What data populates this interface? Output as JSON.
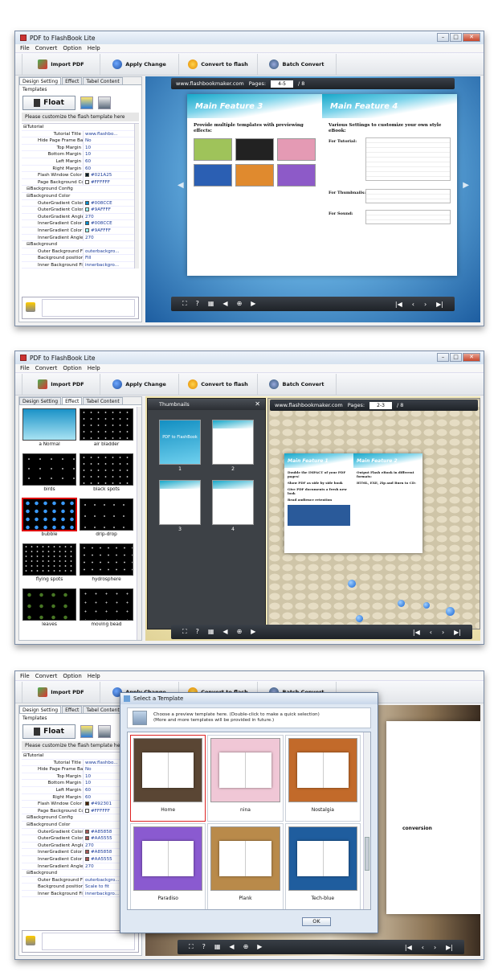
{
  "app": {
    "title": "PDF to FlashBook Lite",
    "menu": [
      "File",
      "Convert",
      "Option",
      "Help"
    ],
    "window_controls": [
      "minimize",
      "maximize",
      "close"
    ]
  },
  "toolbar": {
    "import_pdf": "Import PDF",
    "apply_change": "Apply Change",
    "convert_to_flash": "Convert to flash",
    "batch_convert": "Batch Convert"
  },
  "tabs": [
    "Design Setting",
    "Effect",
    "Tabel Content"
  ],
  "templates_label": "Templates",
  "float_button": "Float",
  "hint": "Please customize the flash template here",
  "props1": [
    {
      "name": "⊟Tutorial",
      "value": "",
      "level": "group"
    },
    {
      "name": "Tutorial Title",
      "value": "www.flashbo...",
      "level": "l2"
    },
    {
      "name": "Hide Page Frame Bar",
      "value": "No",
      "level": "l2"
    },
    {
      "name": "Top Margin",
      "value": "10",
      "level": "l2"
    },
    {
      "name": "Bottom Margin",
      "value": "10",
      "level": "l2"
    },
    {
      "name": "Left Margin",
      "value": "60",
      "level": "l2"
    },
    {
      "name": "Right Margin",
      "value": "60",
      "level": "l2"
    },
    {
      "name": "Flash Window Color",
      "value": "#021A25",
      "level": "l2",
      "swatch": "#021A25"
    },
    {
      "name": "Page Background Color",
      "value": "#FFFFFF",
      "level": "l2",
      "swatch": "#FFFFFF"
    },
    {
      "name": "⊟Background Config",
      "value": "",
      "level": "group2"
    },
    {
      "name": "⊟Background Color",
      "value": "",
      "level": "group2"
    },
    {
      "name": "OuterGradient Color A",
      "value": "#008CCE",
      "level": "l2",
      "swatch": "#008CCE"
    },
    {
      "name": "OuterGradient Color B",
      "value": "#9AFFFF",
      "level": "l2",
      "swatch": "#9AFFFF"
    },
    {
      "name": "OuterGradient Angle",
      "value": "270",
      "level": "l2"
    },
    {
      "name": "InnerGradient Color A",
      "value": "#008CCE",
      "level": "l2",
      "swatch": "#008CCE"
    },
    {
      "name": "InnerGradient Color B",
      "value": "#9AFFFF",
      "level": "l2",
      "swatch": "#9AFFFF"
    },
    {
      "name": "InnerGradient Angle",
      "value": "270",
      "level": "l2"
    },
    {
      "name": "⊟Background",
      "value": "",
      "level": "group2"
    },
    {
      "name": "Outer Background File",
      "value": "outerbackgro...",
      "level": "l2"
    },
    {
      "name": "Background position",
      "value": "Fill",
      "level": "l2"
    },
    {
      "name": "Inner Background File",
      "value": "innerbackgro...",
      "level": "l2"
    }
  ],
  "props3": [
    {
      "name": "⊟Tutorial",
      "value": "",
      "level": "group"
    },
    {
      "name": "Tutorial Title",
      "value": "www.flashbo...",
      "level": "l2"
    },
    {
      "name": "Hide Page Frame Bar",
      "value": "No",
      "level": "l2"
    },
    {
      "name": "Top Margin",
      "value": "10",
      "level": "l2"
    },
    {
      "name": "Bottom Margin",
      "value": "10",
      "level": "l2"
    },
    {
      "name": "Left Margin",
      "value": "60",
      "level": "l2"
    },
    {
      "name": "Right Margin",
      "value": "60",
      "level": "l2"
    },
    {
      "name": "Flash Window Color",
      "value": "#492301",
      "level": "l2",
      "swatch": "#492301"
    },
    {
      "name": "Page Background Color",
      "value": "#FFFFFF",
      "level": "l2",
      "swatch": "#FFFFFF"
    },
    {
      "name": "⊟Background Config",
      "value": "",
      "level": "group2"
    },
    {
      "name": "⊟Background Color",
      "value": "",
      "level": "group2"
    },
    {
      "name": "OuterGradient Color A",
      "value": "#A85858",
      "level": "l2",
      "swatch": "#A85858"
    },
    {
      "name": "OuterGradient Color B",
      "value": "#AA5555",
      "level": "l2",
      "swatch": "#AA5555"
    },
    {
      "name": "OuterGradient Angle",
      "value": "270",
      "level": "l2"
    },
    {
      "name": "InnerGradient Color A",
      "value": "#A85858",
      "level": "l2",
      "swatch": "#A85858"
    },
    {
      "name": "InnerGradient Color B",
      "value": "#AA5555",
      "level": "l2",
      "swatch": "#AA5555"
    },
    {
      "name": "InnerGradient Angle",
      "value": "270",
      "level": "l2"
    },
    {
      "name": "⊟Background",
      "value": "",
      "level": "group2"
    },
    {
      "name": "Outer Background File",
      "value": "outerbackgro...",
      "level": "l2"
    },
    {
      "name": "Background position",
      "value": "Scale to fit",
      "level": "l2"
    },
    {
      "name": "Inner Background File",
      "value": "innerbackgro...",
      "level": "l2"
    }
  ],
  "preview1": {
    "site": "www.flashbookmaker.com",
    "pages_label": "Pages:",
    "page_value": "4-5",
    "page_total": "/ 8",
    "left_title": "Main Feature 3",
    "left_heading": "Provide multiple templates with previewing effects:",
    "right_title": "Main Feature 4",
    "right_heading": "Various Settings to customize your own style eBook:",
    "right_labels": [
      "For Tutorial:",
      "For Thumbnails:",
      "For Sound:"
    ]
  },
  "effects": [
    "a Normal",
    "air bladder",
    "birds",
    "black spots",
    "bubble",
    "drip-drop",
    "flying spots",
    "hydrosphere",
    "leaves",
    "moving bead"
  ],
  "thumbnails": {
    "title": "Thumbnails",
    "cover_text": "PDF to FlashBook",
    "pages": [
      "1",
      "2",
      "3",
      "4"
    ]
  },
  "preview2": {
    "site": "www.flashbookmaker.com",
    "pages_label": "Pages:",
    "page_value": "2-3",
    "page_total": "/ 8",
    "left_title": "Main Feature 1",
    "right_title": "Main Feature 2",
    "left_lines": [
      "Double the IMPACT of your PDF pages!",
      "Show PDF as side by side book",
      "Give PDF documents a fresh new look",
      "Read audience retention"
    ],
    "right_lines": [
      "Output Flash eBook in different formats:",
      "HTML, EXE, Zip and Burn to CD:"
    ]
  },
  "dialog": {
    "title": "Select a Template",
    "info_line1": "Choose a preview template here. (Double-click to make a quick selection)",
    "info_line2": "(More and more templates will be provided in future.)",
    "templates": [
      {
        "name": "Home",
        "selected": true,
        "bg": "#5a4634"
      },
      {
        "name": "nina",
        "selected": false,
        "bg": "#f0c7d6"
      },
      {
        "name": "Nostalgia",
        "selected": false,
        "bg": "#c26a2a"
      },
      {
        "name": "Paradiso",
        "selected": false,
        "bg": "#8a5ad0"
      },
      {
        "name": "Plank",
        "selected": false,
        "bg": "#b98a4a"
      },
      {
        "name": "Tech-blue",
        "selected": false,
        "bg": "#1f5d9e"
      }
    ],
    "ok": "OK"
  },
  "preview3": {
    "right_text": "conversion"
  },
  "colors": {
    "accent_blue": "#1a3a9a",
    "toolbar_dark": "#2b2e33"
  }
}
